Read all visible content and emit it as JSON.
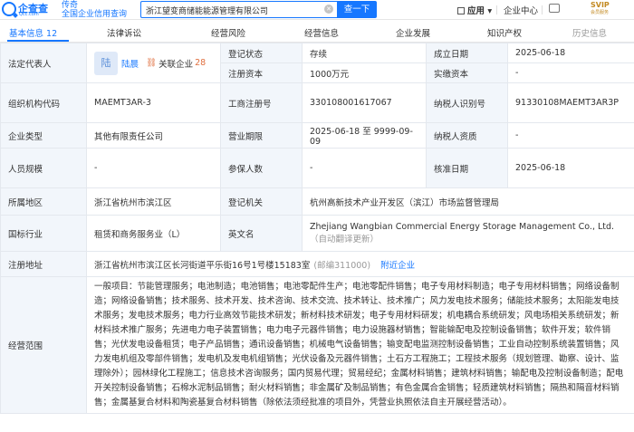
{
  "brand": {
    "name": "企查查",
    "domain": "Qcc.com",
    "slogan_1": "传奇",
    "slogan_2": "全国企业信用查询"
  },
  "search": {
    "value": "浙江望变商储能能源管理有限公司",
    "button": "查一下"
  },
  "nav": {
    "apps": "应用",
    "corp_center": "企业中心",
    "svip_label": "SVIP",
    "svip_sub": "会员服务"
  },
  "tabs": [
    {
      "label": "基本信息",
      "count": "12"
    },
    {
      "label": "法律诉讼",
      "count": ""
    },
    {
      "label": "经营风险",
      "count": ""
    },
    {
      "label": "经营信息",
      "count": ""
    },
    {
      "label": "企业发展",
      "count": ""
    },
    {
      "label": "知识产权",
      "count": ""
    },
    {
      "label": "历史信息",
      "count": ""
    }
  ],
  "info": {
    "legal_rep_label": "法定代表人",
    "legal_rep_avatar": "陆",
    "legal_rep_name": "陆晨",
    "related_label": "关联企业",
    "related_count": "28",
    "reg_status_label": "登记状态",
    "reg_status": "存续",
    "found_date_label": "成立日期",
    "found_date": "2025-06-18",
    "reg_capital_label": "注册资本",
    "reg_capital": "1000万元",
    "paid_capital_label": "实缴资本",
    "paid_capital": "-",
    "org_code_label": "组织机构代码",
    "org_code": "MAEMT3AR-3",
    "biz_reg_no_label": "工商注册号",
    "biz_reg_no": "330108001617067",
    "taxpayer_id_label": "纳税人识别号",
    "taxpayer_id": "91330108MAEMT3AR3P",
    "company_type_label": "企业类型",
    "company_type": "其他有限责任公司",
    "biz_term_label": "营业期限",
    "biz_term": "2025-06-18 至 9999-09-09",
    "taxpayer_qual_label": "纳税人资质",
    "taxpayer_qual": "-",
    "staff_size_label": "人员规模",
    "staff_size": "-",
    "insured_label": "参保人数",
    "insured": "-",
    "approval_date_label": "核准日期",
    "approval_date": "2025-06-18",
    "region_label": "所属地区",
    "region": "浙江省杭州市滨江区",
    "reg_authority_label": "登记机关",
    "reg_authority": "杭州高新技术产业开发区（滨江）市场监督管理局",
    "industry_label": "国标行业",
    "industry": "租赁和商务服务业（L）",
    "en_name_label": "英文名",
    "en_name": "Zhejiang Wangbian Commercial Energy Storage Management Co., Ltd.",
    "en_name_note": "（自动翻译更新）",
    "address_label": "注册地址",
    "address": "浙江省杭州市滨江区长河街道平乐街16号1号楼15183室",
    "postcode": "(邮编311000)",
    "nearby": "附近企业",
    "scope_label": "经营范围",
    "scope": "一般项目：节能管理服务；电池制造；电池销售；电池零配件生产；电池零配件销售；电子专用材料制造；电子专用材料销售；网络设备制造；网络设备销售；技术服务、技术开发、技术咨询、技术交流、技术转让、技术推广；风力发电技术服务；储能技术服务；太阳能发电技术服务；发电技术服务；电力行业高效节能技术研发；新材料技术研发；电子专用材料研发；机电耦合系统研发；风电场相关系统研发；新材料技术推广服务；先进电力电子装置销售；电力电子元器件销售；电力设施器材销售；智能输配电及控制设备销售；软件开发；软件销售；光伏发电设备租赁；电子产品销售；通讯设备销售；机械电气设备销售；输变配电监测控制设备销售；工业自动控制系统装置销售；风力发电机组及零部件销售；发电机及发电机组销售；光伏设备及元器件销售；土石方工程施工；工程技术服务（规划管理、勘察、设计、监理除外）；园林绿化工程施工；信息技术咨询服务；国内贸易代理；贸易经纪；金属材料销售；建筑材料销售；输配电及控制设备制造；配电开关控制设备销售；石棉水泥制品销售；耐火材料销售；非金属矿及制品销售；有色金属合金销售；轻质建筑材料销售；隔热和隔音材料销售；金属基复合材料和陶瓷基复合材料销售（除依法须经批准的项目外，凭营业执照依法自主开展经营活动）。"
  },
  "colors": {
    "accent": "#1677ff",
    "label_bg": "#f2f6fb",
    "border": "#e4e8ee",
    "related": "#e07040"
  }
}
